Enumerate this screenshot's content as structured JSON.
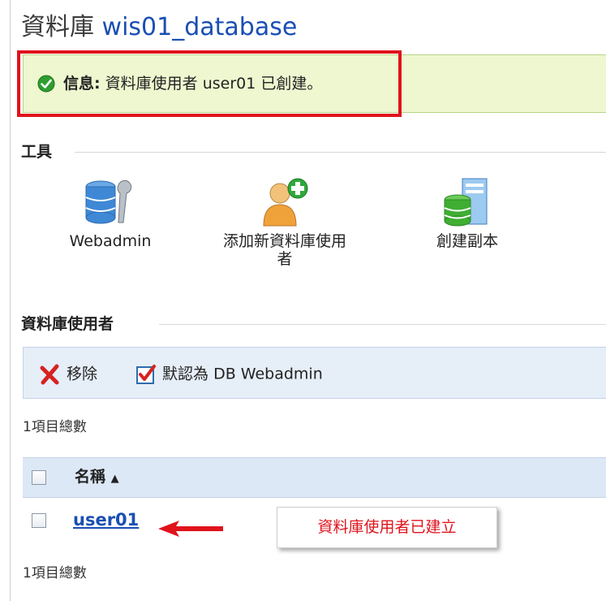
{
  "header": {
    "title_prefix": "資料庫",
    "db_name": "wis01_database"
  },
  "info": {
    "label": "信息:",
    "message": "資料庫使用者 user01 已創建。",
    "icon": "check-circle-icon",
    "color": "#2e9e2e"
  },
  "tools": {
    "heading": "工具",
    "items": [
      {
        "label": "Webadmin",
        "icon": "database-wrench-icon"
      },
      {
        "label_line1": "添加新資料庫使用",
        "label_line2": "者",
        "icon": "add-user-icon"
      },
      {
        "label": "創建副本",
        "icon": "database-server-icon"
      }
    ]
  },
  "users_section": {
    "heading": "資料庫使用者",
    "toolbar": {
      "remove_label": "移除",
      "default_label": "默認為 DB Webadmin"
    },
    "total_top": "1項目總數",
    "table": {
      "columns": [
        "名稱"
      ],
      "sort_indicator": "▲",
      "rows": [
        {
          "name": "user01"
        }
      ]
    },
    "total_bottom": "1項目總數"
  },
  "annotation": {
    "callout_text": "資料庫使用者已建立",
    "color": "#e0121b"
  }
}
